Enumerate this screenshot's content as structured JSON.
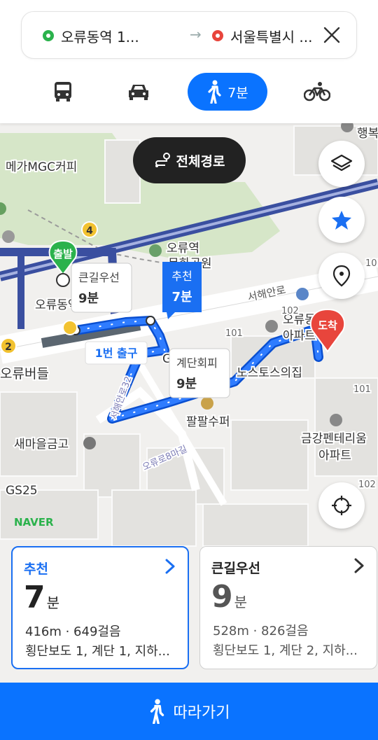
{
  "route": {
    "origin": "오류동역 1...",
    "destination": "서울특별시 ...",
    "arrow": "→"
  },
  "modes": {
    "bus": "bus-icon",
    "car": "car-icon",
    "walk_label": "7분",
    "bike": "bicycle-icon"
  },
  "map": {
    "full_route_label": "전체경로",
    "start_marker": "출발",
    "end_marker": "도착",
    "bubble_recommended": {
      "title": "추천",
      "time": "7분"
    },
    "bubble_main_road": {
      "title": "큰길우선",
      "time": "9분"
    },
    "bubble_stairs": {
      "title": "계단회피",
      "time": "9분"
    },
    "exit_label": "1번 출구",
    "labels": {
      "mega": "메가MGC커피",
      "station_park": "오류역\n문화공원",
      "station": "오류동역",
      "seohae": "서해안로",
      "apt": "오류동 필유\n아파트",
      "buddle": "오류버들",
      "gs": "GS25",
      "gs2": "GS",
      "nosu": "노스토스의집",
      "palpal": "팔팔수퍼",
      "saemaeul": "새마을금고",
      "geumgang": "금강펜테리움\n아파트",
      "road8": "오류로8마길",
      "road32": "서해안로32",
      "haengbok": "행복",
      "naver": "NAVER",
      "n101a": "101",
      "n102a": "102",
      "n101b": "101",
      "n101c": "101",
      "n102b": "102",
      "badge4": "4",
      "badge2": "2"
    }
  },
  "cards": [
    {
      "title": "추천",
      "time": "7",
      "unit": "분",
      "distance": "416m · 649걸음",
      "detail": "횡단보도 1, 계단 1, 지하...",
      "color": "#1a6ff2"
    },
    {
      "title": "큰길우선",
      "time": "9",
      "unit": "분",
      "distance": "528m · 826걸음",
      "detail": "횡단보도 1, 계단 2, 지하...",
      "color": "#222222"
    }
  ],
  "follow_label": "따라가기",
  "colors": {
    "accent": "#0a73ff",
    "origin": "#2bb24c",
    "destination": "#e8453c"
  }
}
